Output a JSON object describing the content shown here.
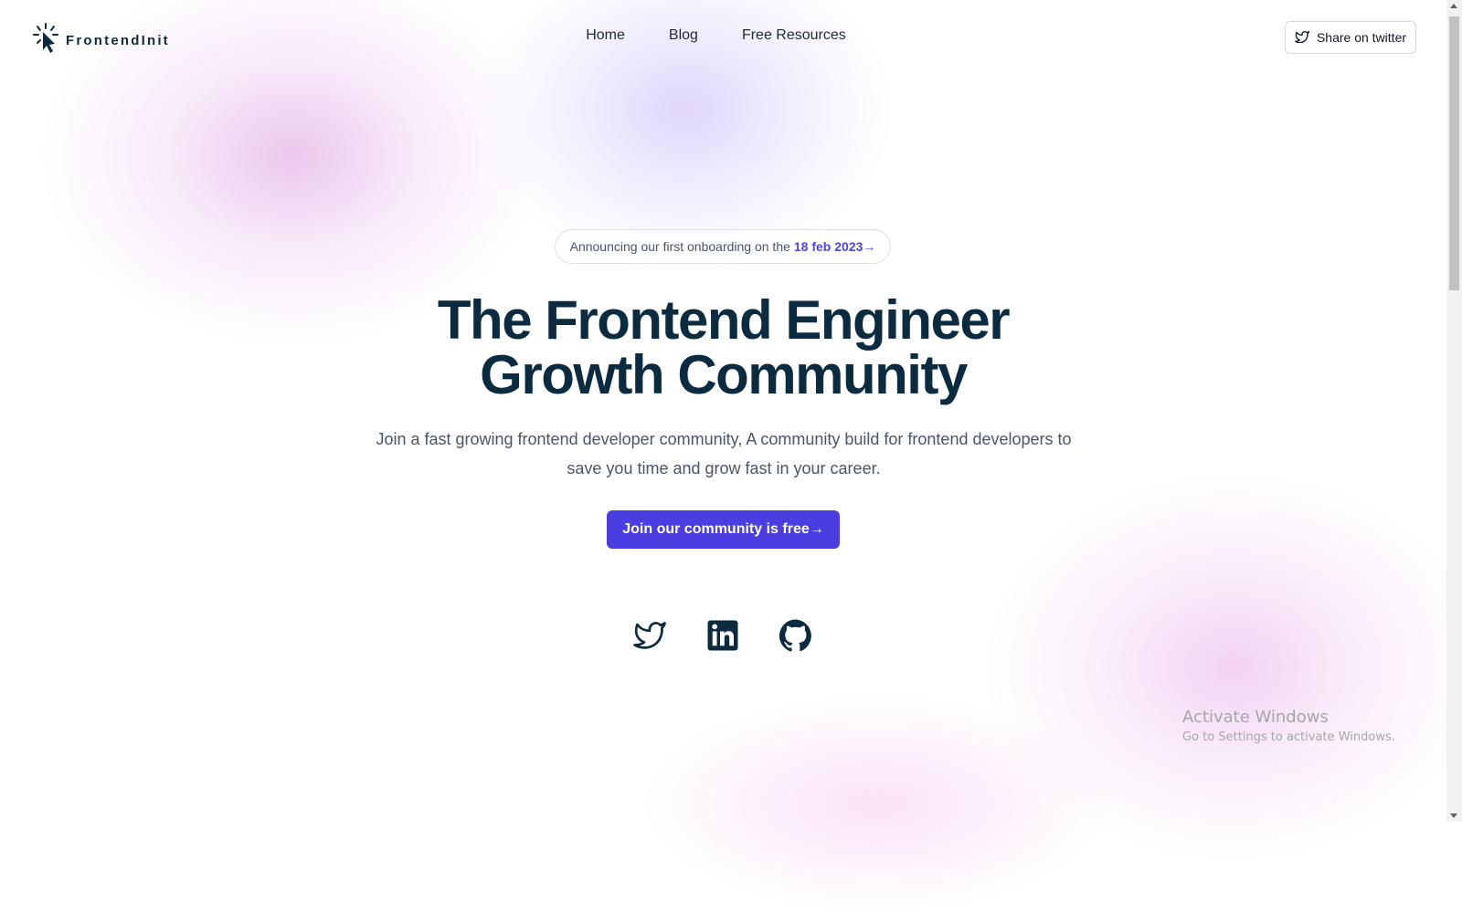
{
  "brand": {
    "name": "FrontendInit",
    "logo_icon": "cursor-click-icon"
  },
  "nav": {
    "items": [
      {
        "label": "Home"
      },
      {
        "label": "Blog"
      },
      {
        "label": "Free Resources"
      }
    ]
  },
  "header": {
    "share_label": "Share on twitter",
    "share_icon": "twitter-icon"
  },
  "hero": {
    "announcement_prefix": "Announcing our first onboarding on the",
    "announcement_date": "18 feb 2023→",
    "title_line1": "The Frontend Engineer",
    "title_line2": "Growth Community",
    "subtitle": "Join a fast growing frontend developer community, A community build for frontend developers to save you time and grow fast in your career.",
    "cta_label": "Join our community is free→"
  },
  "social": {
    "icons": [
      "twitter-icon",
      "linkedin-icon",
      "github-icon"
    ]
  },
  "os_watermark": {
    "title": "Activate Windows",
    "subtitle": "Go to Settings to activate Windows."
  },
  "colors": {
    "accent": "#4a3ee0",
    "date_accent": "#4f46e5",
    "heading": "#0b2b40",
    "text_muted": "#4b5563"
  }
}
